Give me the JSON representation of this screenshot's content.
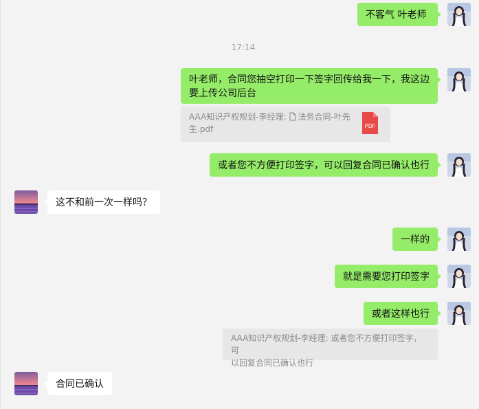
{
  "chat": {
    "timestamp": "17:14",
    "messages": [
      {
        "text": "不客气  叶老师"
      },
      {
        "line1": "叶老师，合同您抽空打印一下签字回传给我一下，我这边",
        "line2": "要上传公司后台"
      },
      {
        "quote_prefix": "AAA知识产权规划-李经理: ",
        "file_name_line1": "法务合同-叶先",
        "file_name_line2": "生.pdf",
        "file_type": "PDF"
      },
      {
        "text": "或者您不方便打印签字，可以回复合同已确认也行"
      },
      {
        "text": "这不和前一次一样吗？"
      },
      {
        "text": "一样的"
      },
      {
        "text": "就是需要您打印签字"
      },
      {
        "text": "或者这样也行"
      },
      {
        "line1": "AAA知识产权规划-李经理: 或者您不方便打印签字，可",
        "line2": "以回复合同已确认也行"
      },
      {
        "text": "合同已确认"
      }
    ]
  },
  "colors": {
    "background": "#f3f3f3",
    "sent_bubble": "#95ec69",
    "received_bubble": "#ffffff",
    "quote_bubble": "#e7e7e7",
    "pdf_icon": "#e84a4a"
  },
  "icons": {
    "self_avatar": "self-avatar",
    "contact_avatar": "contact-avatar",
    "document": "document-icon",
    "pdf": "pdf-file-icon"
  }
}
